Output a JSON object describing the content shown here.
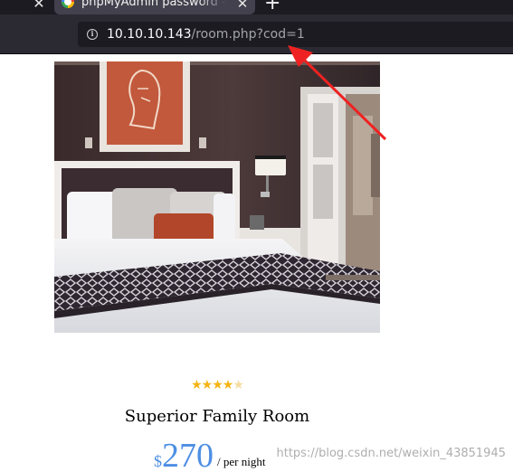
{
  "browser": {
    "tab_title": "phpMyAdmin password - ",
    "tab_close_glyph": "✕",
    "prev_tab_close_glyph": "✕",
    "new_tab_glyph": "+",
    "url_host": "10.10.10.143",
    "url_path": "/room.php?cod=1",
    "icons": {
      "favicon": "google-favicon-icon",
      "info": "info-icon"
    }
  },
  "room": {
    "rating": 4,
    "rating_max": 5,
    "star_glyph": "★",
    "name": "Superior Family Room",
    "currency": "$",
    "price": "270",
    "price_unit": "/ per night"
  },
  "watermark": "https://blog.csdn.net/weixin_43851945",
  "colors": {
    "price": "#4e8fe4",
    "star_filled": "#f5b414",
    "star_empty": "#f5dca0",
    "annotation_arrow": "#ee2222"
  }
}
